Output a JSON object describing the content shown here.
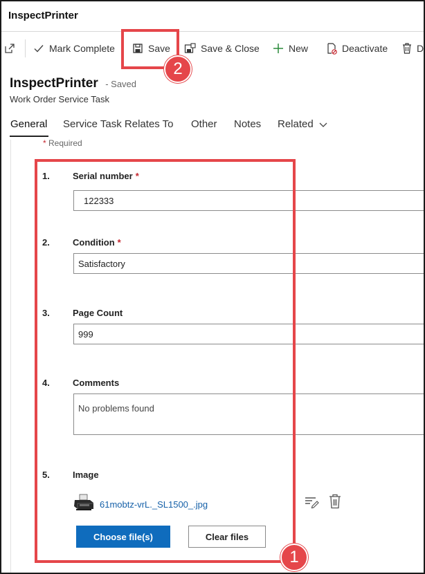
{
  "app": {
    "title": "InspectPrinter"
  },
  "commands": {
    "pop_out_icon": "pop-out-icon",
    "mark_complete": "Mark Complete",
    "save": "Save",
    "save_close": "Save & Close",
    "new": "New",
    "deactivate": "Deactivate",
    "delete_truncated": "D"
  },
  "record": {
    "name": "InspectPrinter",
    "status": "- Saved",
    "entity": "Work Order Service Task"
  },
  "tabs": [
    {
      "label": "General",
      "active": true
    },
    {
      "label": "Service Task Relates To"
    },
    {
      "label": "Other"
    },
    {
      "label": "Notes"
    },
    {
      "label": "Related"
    }
  ],
  "form": {
    "required_marker": "*",
    "required_text": " Required",
    "questions": [
      {
        "number": "1.",
        "label": "Serial number",
        "required": true,
        "value": "122333"
      },
      {
        "number": "2.",
        "label": "Condition",
        "required": true,
        "value": "Satisfactory"
      },
      {
        "number": "3.",
        "label": "Page Count",
        "required": false,
        "value": "999"
      },
      {
        "number": "4.",
        "label": "Comments",
        "required": false,
        "value": "No problems found"
      },
      {
        "number": "5.",
        "label": "Image",
        "required": false,
        "file_name": "61mobtz-vrL._SL1500_.jpg"
      }
    ],
    "choose_files": "Choose file(s)",
    "clear_files": "Clear files"
  },
  "annotations": {
    "callout_1": "1",
    "callout_2": "2",
    "color": "#e5464a"
  },
  "colors": {
    "primary": "#0f6cbd",
    "link": "#1560a8",
    "required": "#c4262e"
  }
}
